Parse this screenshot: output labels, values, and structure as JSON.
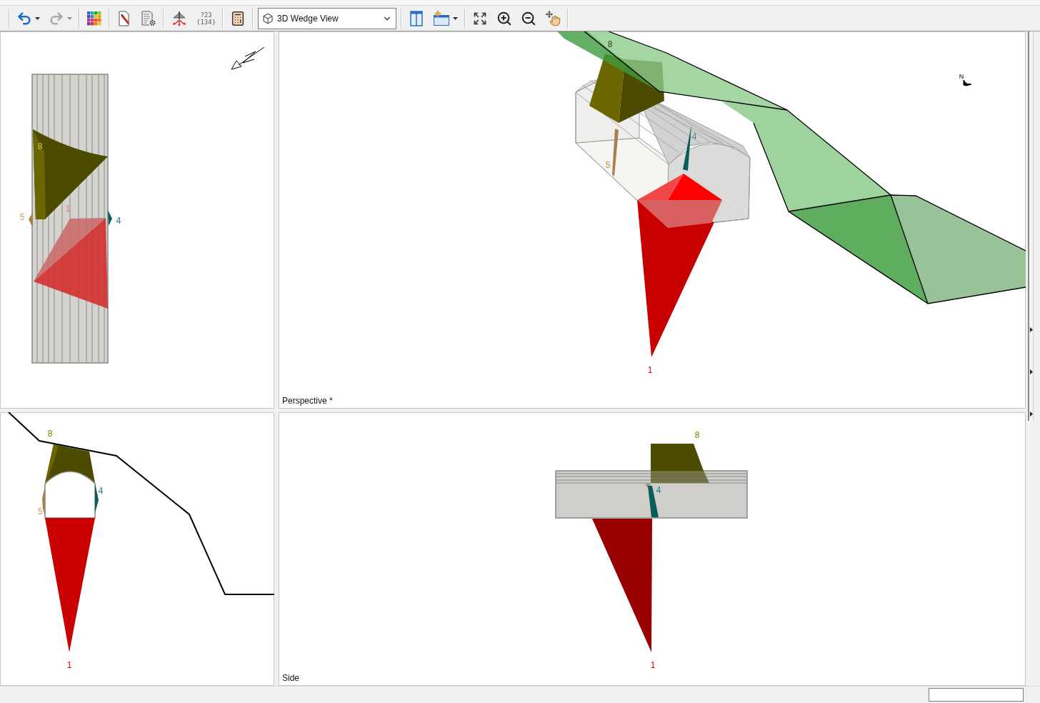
{
  "toolbar": {
    "groups": [
      {
        "items": [
          {
            "kind": "undo",
            "menu": true,
            "disabled": false
          },
          {
            "kind": "redo",
            "menu": true,
            "disabled": true
          }
        ]
      },
      {
        "items": [
          {
            "kind": "palette",
            "menu": false,
            "disabled": false
          }
        ]
      },
      {
        "items": [
          {
            "kind": "document",
            "menu": false,
            "disabled": false
          },
          {
            "kind": "settings",
            "menu": false,
            "disabled": false
          }
        ]
      },
      {
        "items": [
          {
            "kind": "support",
            "menu": false,
            "disabled": false
          },
          {
            "kind": "numbering",
            "menu": false,
            "disabled": true,
            "lines": [
              "?23",
              "{134}"
            ]
          }
        ]
      },
      {
        "items": [
          {
            "kind": "calculator",
            "menu": false,
            "disabled": false
          }
        ]
      },
      {
        "items": [
          {
            "kind": "select",
            "menu": true,
            "disabled": false,
            "value": "3D Wedge View"
          }
        ]
      },
      {
        "items": [
          {
            "kind": "layout",
            "menu": false,
            "disabled": false
          },
          {
            "kind": "window",
            "menu": true,
            "disabled": false
          }
        ]
      },
      {
        "items": [
          {
            "kind": "fit",
            "menu": false,
            "disabled": false
          },
          {
            "kind": "zoomin",
            "menu": false,
            "disabled": false
          },
          {
            "kind": "zoomout",
            "menu": false,
            "disabled": false
          },
          {
            "kind": "pan",
            "menu": false,
            "disabled": false
          }
        ]
      }
    ]
  },
  "views": [
    {
      "kind": "top",
      "wedge_labels": [
        {
          "text": "8",
          "color": "#c8c850"
        },
        {
          "text": "1",
          "color": "#e07a7a"
        },
        {
          "text": "5",
          "color": "#c8a060"
        },
        {
          "text": "4",
          "color": "#107f8a"
        }
      ]
    },
    {
      "kind": "perspective",
      "caption": "Perspective *",
      "compass_label": "N",
      "wedge_labels": [
        {
          "text": "8",
          "color": "#3a3a00"
        },
        {
          "text": "4",
          "color": "#3f8a8c"
        },
        {
          "text": "5",
          "color": "#c09050"
        },
        {
          "text": "1",
          "color": "#e00000"
        }
      ]
    },
    {
      "kind": "front",
      "wedge_labels": [
        {
          "text": "8",
          "color": "#7f7f00"
        },
        {
          "text": "4",
          "color": "#108a90"
        },
        {
          "text": "5",
          "color": "#c8a060"
        },
        {
          "text": "1",
          "color": "#e00000"
        }
      ]
    },
    {
      "kind": "side",
      "caption": "Side",
      "wedge_labels": [
        {
          "text": "8",
          "color": "#7f7f00"
        },
        {
          "text": "4",
          "color": "#0e7f86"
        },
        {
          "text": "1",
          "color": "#e00000"
        }
      ]
    }
  ]
}
